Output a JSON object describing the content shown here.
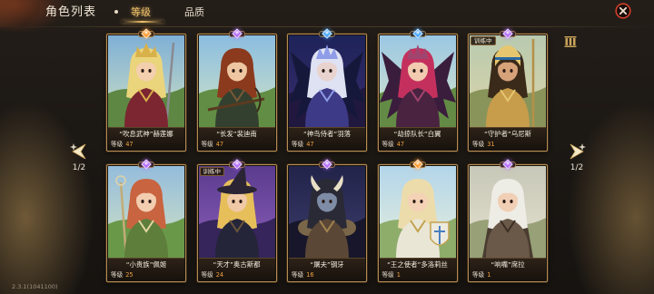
{
  "header": {
    "title": "角色列表",
    "tabs": [
      {
        "label": "等级",
        "active": true
      },
      {
        "label": "品质",
        "active": false
      }
    ]
  },
  "labels": {
    "level": "等级"
  },
  "pager": {
    "left": "1/2",
    "right": "1/2"
  },
  "icons": {
    "close": "close-icon",
    "sort": "sort-icon",
    "prev": "chevron-left-icon",
    "next": "chevron-right-icon"
  },
  "colors": {
    "level_value": "#f0a040",
    "tab_active": "#f3c46a",
    "close_ring": "#d2402a"
  },
  "cards": [
    {
      "name": "“吹息武神”赫莲娜",
      "level": "47",
      "gem_color": "#ff9a2e"
    },
    {
      "name": "“长发”裴迪南",
      "level": "47",
      "gem_color": "#b46cff"
    },
    {
      "name": "“神鸟侍者”羽落",
      "level": "47",
      "gem_color": "#49a6ff"
    },
    {
      "name": "“劫掠队长”白翼",
      "level": "47",
      "gem_color": "#49a6ff"
    },
    {
      "name": "“守护者”乌尼斯",
      "level": "31",
      "gem_color": "#b46cff",
      "training": "训练中"
    },
    {
      "name": "“小贵族”佩姬",
      "level": "25",
      "gem_color": "#b46cff"
    },
    {
      "name": "“天才”奥古斯都",
      "level": "24",
      "gem_color": "#b46cff",
      "training": "训练中"
    },
    {
      "name": "“屠夫”钢牙",
      "level": "16",
      "gem_color": "#b46cff"
    },
    {
      "name": "“王之使者”多洛莉丝",
      "level": "1",
      "gem_color": "#ff9a2e"
    },
    {
      "name": "“响嘴”席拉",
      "level": "1",
      "gem_color": "#b46cff"
    }
  ],
  "version": "2.3.1(1041100)"
}
